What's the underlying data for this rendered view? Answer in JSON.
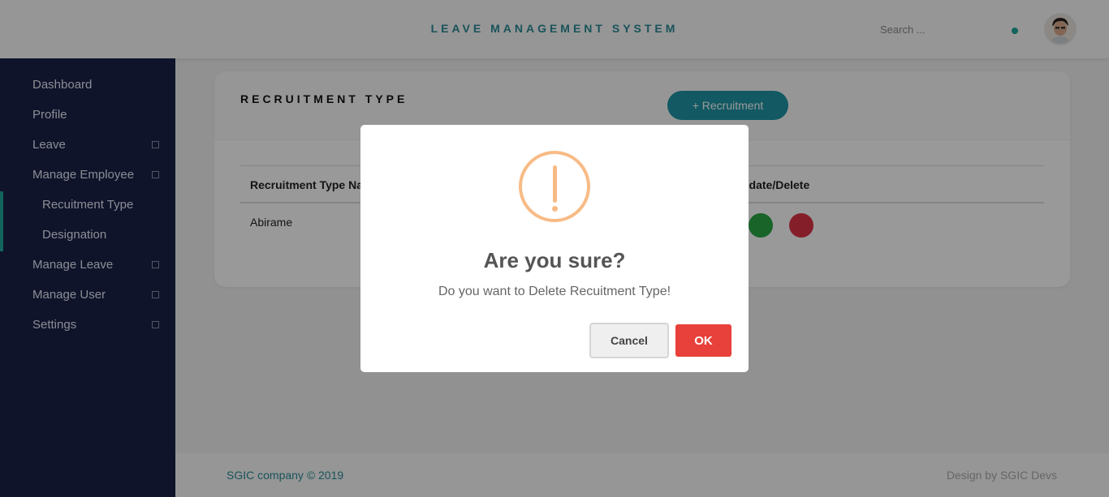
{
  "header": {
    "title": "LEAVE MANAGEMENT SYSTEM",
    "search_placeholder": "Search ...",
    "status_color": "#1fa79a"
  },
  "sidebar": {
    "items": [
      {
        "label": "Dashboard",
        "has_submenu": false
      },
      {
        "label": "Profile",
        "has_submenu": false
      },
      {
        "label": "Leave",
        "has_submenu": true
      },
      {
        "label": "Manage Employee",
        "has_submenu": true
      },
      {
        "label": "Recuitment Type",
        "submenu_item": true,
        "active": true
      },
      {
        "label": "Designation",
        "submenu_item": true
      },
      {
        "label": "Manage Leave",
        "has_submenu": true
      },
      {
        "label": "Manage User",
        "has_submenu": true
      },
      {
        "label": "Settings",
        "has_submenu": true
      }
    ]
  },
  "card": {
    "title": "RECRUITMENT TYPE",
    "add_button": "+ Recruitment",
    "columns": [
      "Recruitment Type Na",
      "pdate/Delete"
    ],
    "rows": [
      {
        "name": "Abirame",
        "actions": [
          "edit",
          "delete"
        ]
      }
    ],
    "edit_color": "#28a745",
    "delete_color": "#dc3545"
  },
  "footer": {
    "copyright": "SGIC company © 2019",
    "credit": "Design by SGIC Devs"
  },
  "modal": {
    "icon": "warning-icon",
    "title": "Are you sure?",
    "text": "Do you want to Delete Recuitment Type!",
    "cancel_label": "Cancel",
    "ok_label": "OK"
  }
}
